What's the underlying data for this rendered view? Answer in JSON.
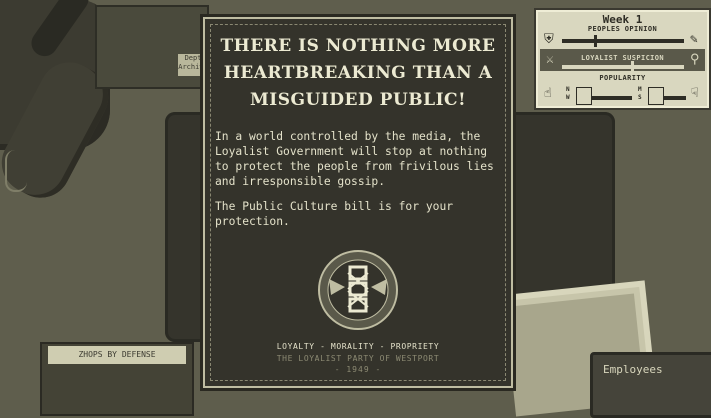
{
  "poster": {
    "headline_lines": [
      "THERE IS NOTHING MORE",
      "HEARTBREAKING THAN A",
      "MISGUIDED PUBLIC!"
    ],
    "paragraph1": "In a world controlled by the media, the Loyalist Government will stop at nothing to protect the people from frivilous lies and irresponsible gossip.",
    "paragraph2": "The Public Culture bill is for your protection.",
    "emblem_ring_text": "LOYALTY · MORALITY",
    "motto": "LOYALTY - MORALITY - PROPRIETY",
    "party": "THE LOYALIST PARTY OF WESTPORT",
    "year": "- 1949 -"
  },
  "hud": {
    "week": "Week 1",
    "peoples_opinion": "PEOPLES OPINION",
    "loyalist_suspicion": "LOYALIST SUSPICION",
    "popularity": "POPULARITY",
    "popularity_left_letters": "N W",
    "popularity_right_letters": "M S",
    "peoples_opinion_level": 0.27,
    "loyalist_suspicion_level": 0.58
  },
  "desk": {
    "tray_label": "Dept Archive",
    "card_label": "ZHOPS BY DEFENSE",
    "employees_label": "Employees"
  },
  "colors": {
    "desk": "#5f5e4d",
    "poster_bg": "#34332b",
    "poster_text": "#ecead2",
    "hud_bg": "#d9d7bf",
    "hud_dark": "#2e2d25"
  },
  "icons": [
    "shield-icon",
    "quill-icon",
    "crossed-swords-icon",
    "torch-icon",
    "thumbs-up-icon",
    "thumbs-down-icon"
  ]
}
